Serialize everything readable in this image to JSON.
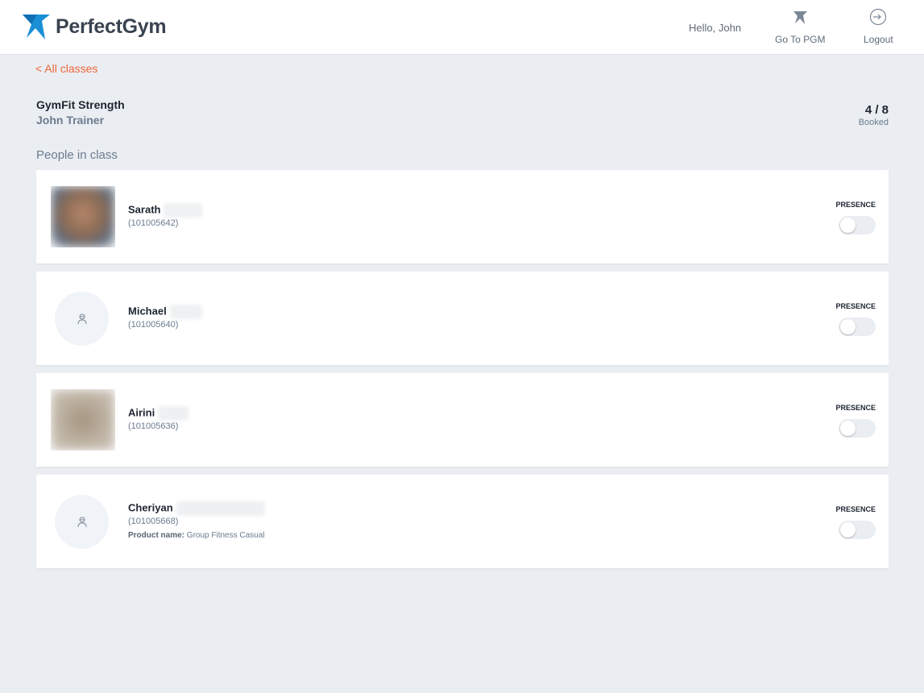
{
  "header": {
    "brand": "PerfectGym",
    "greeting": "Hello, John",
    "go_to_pgm": "Go To PGM",
    "logout": "Logout"
  },
  "nav": {
    "back_label": "< All classes"
  },
  "class_info": {
    "name": "GymFit Strength",
    "trainer": "John Trainer",
    "booked": "4 / 8",
    "booked_label": "Booked"
  },
  "section_title": "People in class",
  "presence_label": "PRESENCE",
  "people": [
    {
      "name": "Sarath",
      "id": "(101005642)",
      "has_photo": true,
      "present": false
    },
    {
      "name": "Michael",
      "id": "(101005640)",
      "has_photo": false,
      "present": false
    },
    {
      "name": "Airini",
      "id": "(101005636)",
      "has_photo": true,
      "present": false
    },
    {
      "name": "Cheriyan",
      "id": "(101005668)",
      "has_photo": false,
      "present": false,
      "product_label": "Product name:",
      "product_value": "Group Fitness Casual"
    }
  ],
  "colors": {
    "accent": "#f0663a",
    "brand_blue": "#1a8fd6",
    "background": "#eaeef2"
  }
}
